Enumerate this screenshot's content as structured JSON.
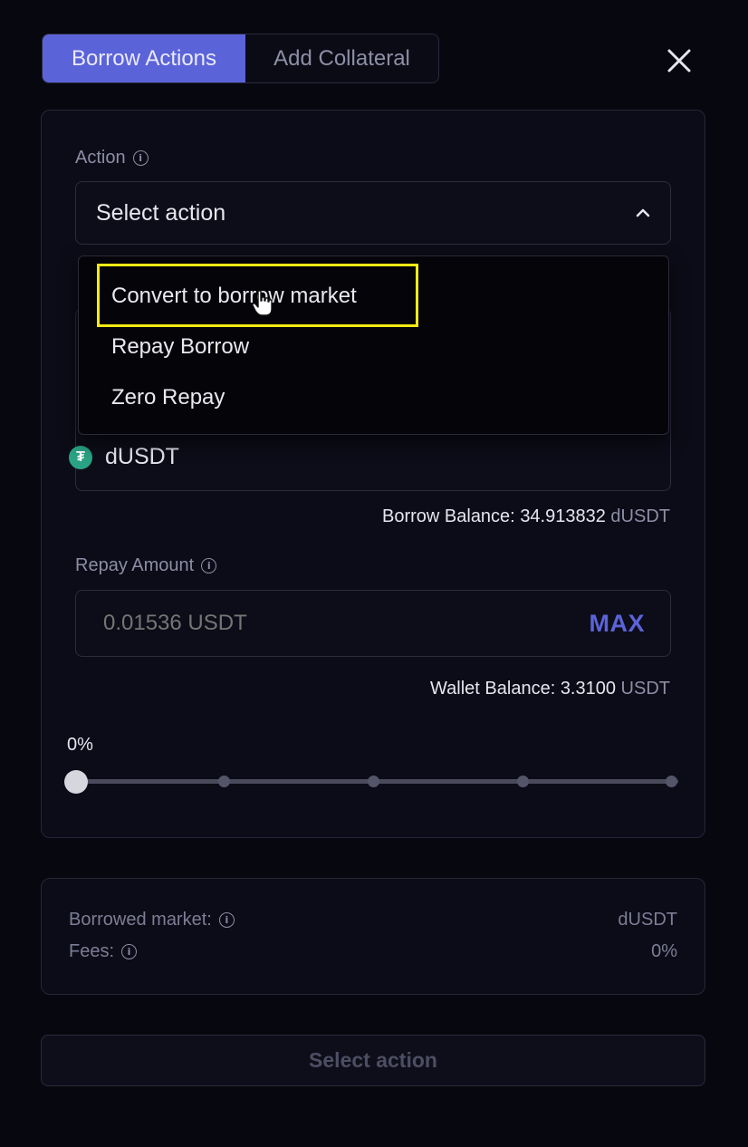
{
  "tabs": [
    {
      "label": "Borrow Actions",
      "active": true
    },
    {
      "label": "Add Collateral",
      "active": false
    }
  ],
  "close_icon": "close-icon",
  "action": {
    "label": "Action",
    "selected": "Select action",
    "options": [
      "Convert to borrow market",
      "Repay Borrow",
      "Zero Repay"
    ],
    "hovered_option": "Convert to borrow market"
  },
  "market": {
    "token": "dUSDT",
    "icon": "tether-icon",
    "borrow_balance_label": "Borrow Balance:",
    "borrow_balance_value": "34.913832",
    "borrow_balance_unit": "dUSDT"
  },
  "repay": {
    "label": "Repay Amount",
    "placeholder": "0.01536 USDT",
    "max_label": "MAX",
    "wallet_balance_label": "Wallet Balance:",
    "wallet_balance_value": "3.3100",
    "wallet_balance_unit": "USDT"
  },
  "slider": {
    "percent_label": "0%",
    "value": 0
  },
  "summary": {
    "borrowed_market_label": "Borrowed market:",
    "borrowed_market_value": "dUSDT",
    "fees_label": "Fees:",
    "fees_value": "0%"
  },
  "submit_label": "Select action",
  "colors": {
    "accent": "#5b63d8",
    "highlight": "#f5ea14",
    "background": "#07070f",
    "tether": "#2aa384"
  }
}
